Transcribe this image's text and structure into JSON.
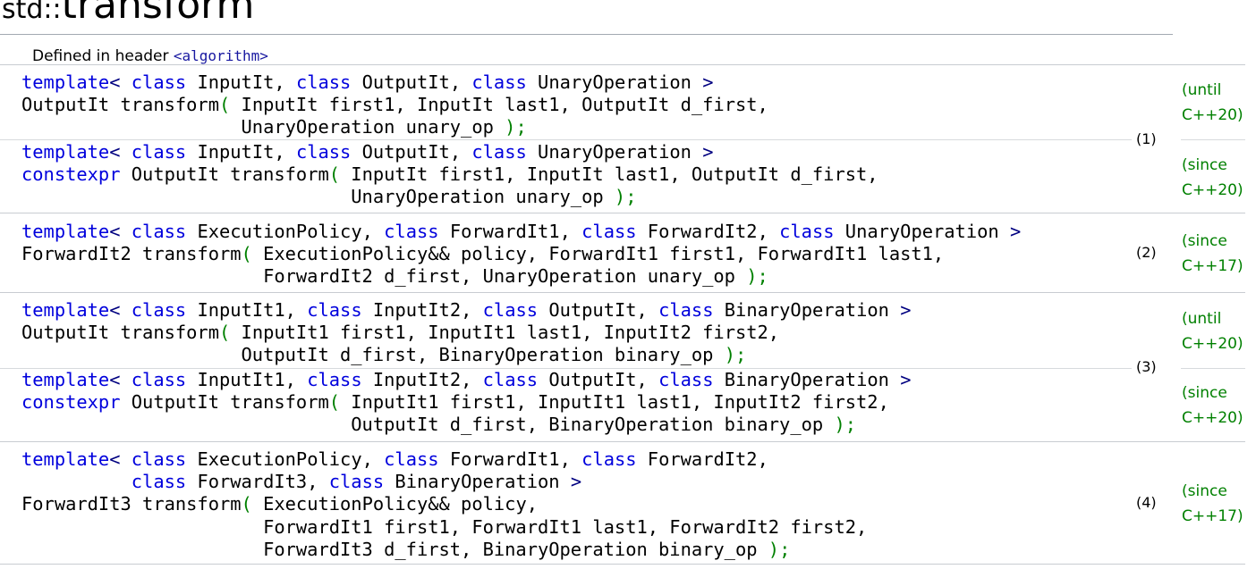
{
  "page": {
    "title_namespace": "std::",
    "title_name": "transform",
    "defined_in_label": "Defined in header ",
    "header_name": "<algorithm>"
  },
  "declarations": [
    {
      "number": "(1)",
      "variants": [
        {
          "standard_word": "(until",
          "standard_version": "C++20)",
          "lines": [
            "template< class InputIt, class OutputIt, class UnaryOperation >",
            "OutputIt transform( InputIt first1, InputIt last1, OutputIt d_first,",
            "                    UnaryOperation unary_op );"
          ]
        },
        {
          "standard_word": "(since",
          "standard_version": "C++20)",
          "lines": [
            "template< class InputIt, class OutputIt, class UnaryOperation >",
            "constexpr OutputIt transform( InputIt first1, InputIt last1, OutputIt d_first,",
            "                              UnaryOperation unary_op );"
          ]
        }
      ]
    },
    {
      "number": "(2)",
      "variants": [
        {
          "standard_word": "(since",
          "standard_version": "C++17)",
          "lines": [
            "template< class ExecutionPolicy, class ForwardIt1, class ForwardIt2, class UnaryOperation >",
            "ForwardIt2 transform( ExecutionPolicy&& policy, ForwardIt1 first1, ForwardIt1 last1,",
            "                      ForwardIt2 d_first, UnaryOperation unary_op );"
          ]
        }
      ]
    },
    {
      "number": "(3)",
      "variants": [
        {
          "standard_word": "(until",
          "standard_version": "C++20)",
          "lines": [
            "template< class InputIt1, class InputIt2, class OutputIt, class BinaryOperation >",
            "OutputIt transform( InputIt1 first1, InputIt1 last1, InputIt2 first2,",
            "                    OutputIt d_first, BinaryOperation binary_op );"
          ]
        },
        {
          "standard_word": "(since",
          "standard_version": "C++20)",
          "lines": [
            "template< class InputIt1, class InputIt2, class OutputIt, class BinaryOperation >",
            "constexpr OutputIt transform( InputIt1 first1, InputIt1 last1, InputIt2 first2,",
            "                              OutputIt d_first, BinaryOperation binary_op );"
          ]
        }
      ]
    },
    {
      "number": "(4)",
      "variants": [
        {
          "standard_word": "(since",
          "standard_version": "C++17)",
          "lines": [
            "template< class ExecutionPolicy, class ForwardIt1, class ForwardIt2,",
            "          class ForwardIt3, class BinaryOperation >",
            "ForwardIt3 transform( ExecutionPolicy&& policy,",
            "                      ForwardIt1 first1, ForwardIt1 last1, ForwardIt2 first2,",
            "                      ForwardIt3 d_first, BinaryOperation binary_op );"
          ]
        }
      ]
    }
  ]
}
